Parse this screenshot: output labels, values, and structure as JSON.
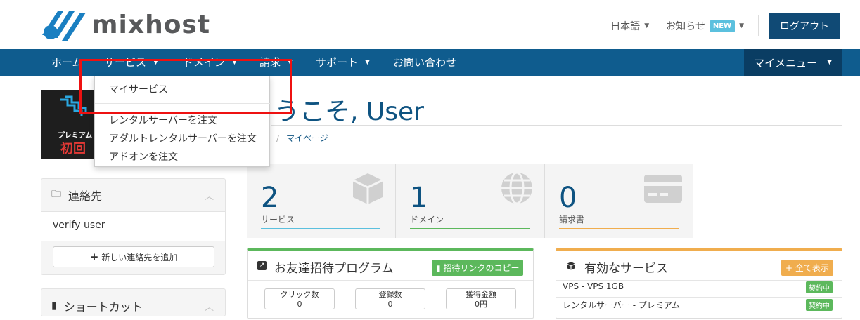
{
  "header": {
    "logo_text": "mixhost",
    "language": "日本語",
    "notices": "お知らせ",
    "new_badge": "NEW",
    "logout": "ログアウト"
  },
  "nav": {
    "items": [
      {
        "label": "ホーム"
      },
      {
        "label": "サービス"
      },
      {
        "label": "ドメイン"
      },
      {
        "label": "請求"
      },
      {
        "label": "サポート"
      },
      {
        "label": "お問い合わせ"
      }
    ],
    "my_menu": "マイメニュー"
  },
  "services_dropdown": {
    "items": [
      "マイサービス",
      "レンタルサーバーを注文",
      "アダルトレンタルサーバーを注文",
      "アドオンを注文"
    ]
  },
  "banner": {
    "line1": "プレミアム",
    "line2": "初回"
  },
  "welcome": {
    "title": "うこそ, User",
    "breadcrumb_current": "マイページ"
  },
  "contacts_panel": {
    "title": "連絡先",
    "user": "verify user",
    "add_button": "新しい連絡先を追加"
  },
  "shortcut_panel": {
    "title": "ショートカット"
  },
  "stats": [
    {
      "value": "2",
      "label": "サービス",
      "color": "#5bc0de",
      "icon": "box-icon"
    },
    {
      "value": "1",
      "label": "ドメイン",
      "color": "#5cb85c",
      "icon": "globe-icon"
    },
    {
      "value": "0",
      "label": "請求書",
      "color": "#f0ad4e",
      "icon": "credit-card-icon"
    }
  ],
  "referral": {
    "title": "お友達招待プログラム",
    "copy_button": "招待リンクのコピー",
    "metrics": [
      {
        "label": "クリック数",
        "value": "0"
      },
      {
        "label": "登録数",
        "value": "0"
      },
      {
        "label": "獲得金額",
        "value": "0円"
      }
    ]
  },
  "active_services": {
    "title": "有効なサービス",
    "view_all": "全て表示",
    "rows": [
      {
        "name": "VPS - VPS 1GB",
        "status": "契約中"
      },
      {
        "name": "レンタルサーバー - プレミアム",
        "status": "契約中"
      }
    ]
  },
  "colors": {
    "navbar": "#0f5c8e",
    "accent": "#104a75",
    "highlight_box": "#e11111"
  }
}
